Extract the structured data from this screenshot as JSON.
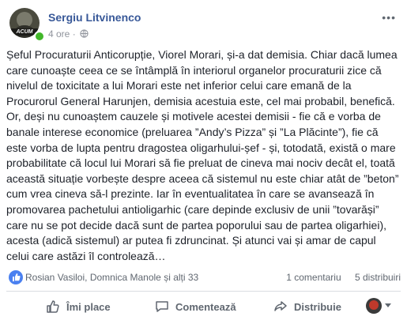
{
  "header": {
    "author": "Sergiu Litvinenco",
    "time": "4 ore",
    "separator": "·",
    "avatar_tag": "ACUM",
    "more_label": "•••"
  },
  "post": {
    "text": "Șeful Procuraturii Anticorupție, Viorel Morari, și-a dat demisia. Chiar dacă lumea care cunoaște ceea ce se întâmplă în interiorul organelor procuraturii zice că nivelul de toxicitate a lui Morari este net inferior celui care emană de la Procurorul General Harunjen, demisia acestuia este, cel mai probabil, benefică. Or, deși nu cunoaștem cauzele și motivele acestei demisii - fie că e vorba de banale interese economice (preluarea ”Andy’s Pizza” și ”La Plăcinte”), fie că este vorba de lupta pentru dragostea oligarhului-șef - și, totodată, există o mare probabilitate că locul lui Morari să fie preluat de cineva mai nociv decât el, toată această situație vorbește despre aceea că sistemul nu este chiar atât de ”beton” cum vrea cineva să-l prezinte. Iar în eventualitatea în care se avansează în promovarea pachetului antioligarhic (care depinde exclusiv de unii ”tovarăși” care nu se pot decide dacă sunt de partea poporului sau de partea oligarhiei), acesta (adică sistemul) ar putea fi zdruncinat. Și atunci vai și amar de capul celui care astăzi îl controlează…"
  },
  "reactions": {
    "names": "Rosian Vasiloi, Domnica Manole și alți 33",
    "comments": "1 comentariu",
    "shares": "5 distribuiri",
    "like_color": "#4a80f0"
  },
  "actions": {
    "like": "Îmi place",
    "comment": "Comentează",
    "share": "Distribuie"
  },
  "colors": {
    "author": "#385898",
    "text": "#1d2129",
    "muted": "#606770",
    "online": "#42b72a"
  }
}
